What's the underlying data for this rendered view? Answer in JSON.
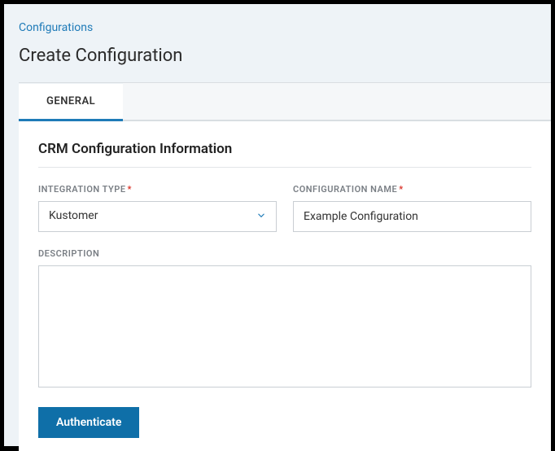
{
  "breadcrumb": {
    "label": "Configurations"
  },
  "page": {
    "title": "Create Configuration"
  },
  "tabs": {
    "general": "GENERAL"
  },
  "section": {
    "title": "CRM Configuration Information"
  },
  "form": {
    "integration_type": {
      "label": "INTEGRATION TYPE",
      "value": "Kustomer"
    },
    "configuration_name": {
      "label": "CONFIGURATION NAME",
      "value": "Example Configuration"
    },
    "description": {
      "label": "DESCRIPTION",
      "value": ""
    }
  },
  "buttons": {
    "authenticate": "Authenticate"
  }
}
